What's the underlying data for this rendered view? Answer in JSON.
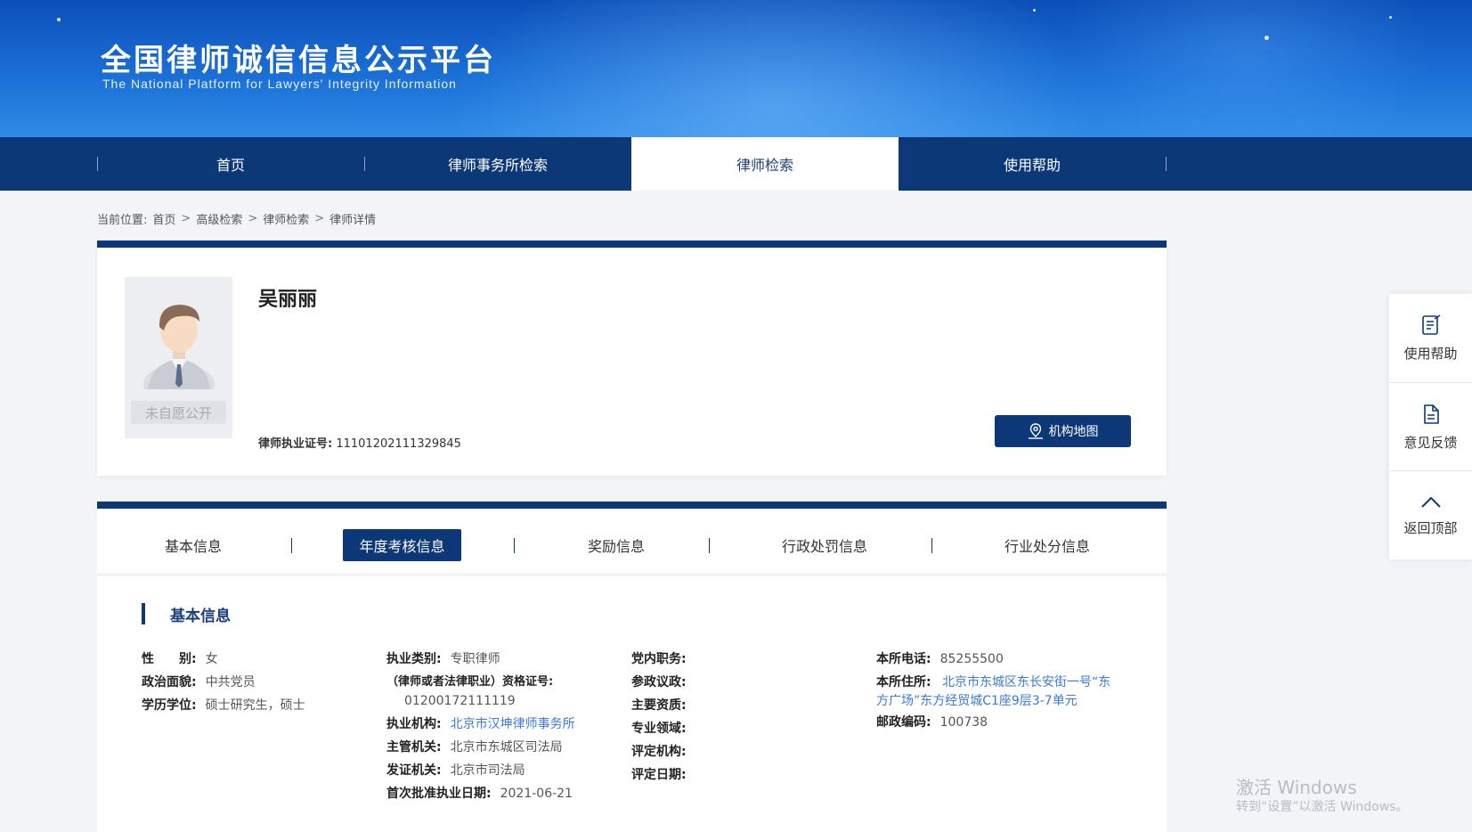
{
  "header": {
    "title": "全国律师诚信信息公示平台",
    "subtitle": "The National Platform for  Lawyers' Integrity Information"
  },
  "nav": {
    "items": [
      {
        "label": "首页"
      },
      {
        "label": "律师事务所检索"
      },
      {
        "label": "律师检索"
      },
      {
        "label": "使用帮助"
      }
    ],
    "active": "律师检索"
  },
  "breadcrumb": {
    "prefix": "当前位置:",
    "items": [
      "首页",
      "高级检索",
      "律师检索",
      "律师详情"
    ],
    "separator": ">"
  },
  "profile": {
    "photo_badge": "未自愿公开",
    "name": "吴丽丽",
    "cert_label": "律师执业证号:",
    "cert_value": "11101202111329845",
    "map_button": "机构地图"
  },
  "tabs": {
    "items": [
      "基本信息",
      "年度考核信息",
      "奖励信息",
      "行政处罚信息",
      "行业处分信息"
    ],
    "active": "年度考核信息"
  },
  "info": {
    "section_title": "基本信息",
    "col1": [
      {
        "k": "性　　别:",
        "v": "女"
      },
      {
        "k": "政治面貌:",
        "v": "中共党员"
      },
      {
        "k": "学历学位:",
        "v": "硕士研究生，硕士"
      }
    ],
    "col2": {
      "practice_type_label": "执业类别:",
      "practice_type_value": "专职律师",
      "qual_label": "（律师或者法律职业）资格证号:",
      "qual_value": "01200172111119",
      "org_label": "执业机构:",
      "org_value": "北京市汉坤律师事务所",
      "authority_label": "主管机关:",
      "authority_value": "北京市东城区司法局",
      "issuer_label": "发证机关:",
      "issuer_value": "北京市司法局",
      "first_date_label": "首次批准执业日期:",
      "first_date_value": "2021-06-21"
    },
    "col3": [
      {
        "k": "党内职务:",
        "v": ""
      },
      {
        "k": "参政议政:",
        "v": ""
      },
      {
        "k": "主要资质:",
        "v": ""
      },
      {
        "k": "专业领域:",
        "v": ""
      },
      {
        "k": "评定机构:",
        "v": ""
      },
      {
        "k": "评定日期:",
        "v": ""
      }
    ],
    "col4": {
      "phone_label": "本所电话:",
      "phone_value": "85255500",
      "address_label": "本所住所:",
      "address_value": "北京市东城区东长安街一号“东方广场”东方经贸城C1座9层3-7单元",
      "postcode_label": "邮政编码:",
      "postcode_value": "100738"
    }
  },
  "side_panel": {
    "help": "使用帮助",
    "feedback": "意见反馈",
    "top": "返回顶部"
  },
  "watermark": {
    "line1": "激活 Windows",
    "line2": "转到“设置”以激活 Windows。"
  },
  "colors": {
    "primary": "#0d3878",
    "link": "#3a7ad8",
    "banner": "#1a6fd6"
  }
}
